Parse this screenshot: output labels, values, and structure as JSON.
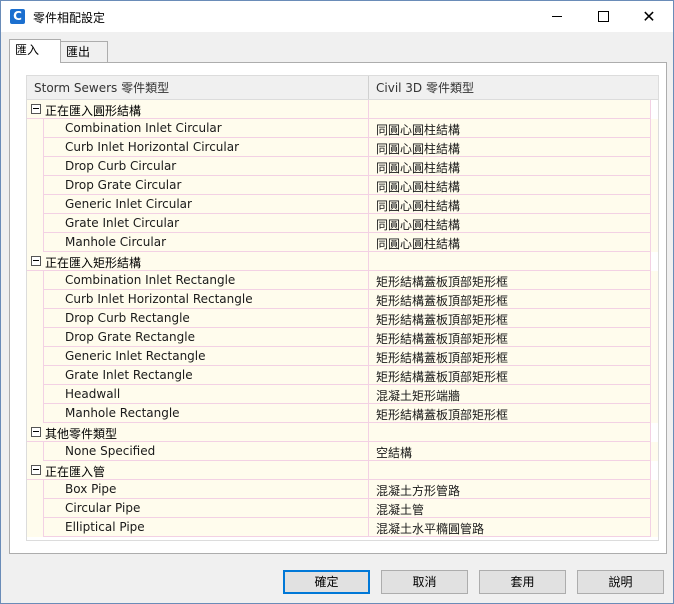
{
  "window": {
    "title": "零件相配設定",
    "app_icon_letter": "C"
  },
  "tabs": [
    {
      "label": "匯入",
      "active": true
    },
    {
      "label": "匯出",
      "active": false
    }
  ],
  "grid": {
    "columns": [
      "Storm Sewers 零件類型",
      "Civil 3D 零件類型"
    ],
    "groups": [
      {
        "label": "正在匯入圓形結構",
        "items": [
          {
            "name": "Combination Inlet Circular",
            "value": "同圓心圓柱結構"
          },
          {
            "name": "Curb Inlet Horizontal Circular",
            "value": "同圓心圓柱結構"
          },
          {
            "name": "Drop Curb Circular",
            "value": "同圓心圓柱結構"
          },
          {
            "name": "Drop Grate Circular",
            "value": "同圓心圓柱結構"
          },
          {
            "name": "Generic Inlet Circular",
            "value": "同圓心圓柱結構"
          },
          {
            "name": "Grate Inlet Circular",
            "value": "同圓心圓柱結構"
          },
          {
            "name": "Manhole Circular",
            "value": "同圓心圓柱結構"
          }
        ]
      },
      {
        "label": "正在匯入矩形結構",
        "items": [
          {
            "name": "Combination Inlet Rectangle",
            "value": "矩形結構蓋板頂部矩形框"
          },
          {
            "name": "Curb Inlet Horizontal Rectangle",
            "value": "矩形結構蓋板頂部矩形框"
          },
          {
            "name": "Drop Curb Rectangle",
            "value": "矩形結構蓋板頂部矩形框"
          },
          {
            "name": "Drop Grate Rectangle",
            "value": "矩形結構蓋板頂部矩形框"
          },
          {
            "name": "Generic Inlet Rectangle",
            "value": "矩形結構蓋板頂部矩形框"
          },
          {
            "name": "Grate Inlet Rectangle",
            "value": "矩形結構蓋板頂部矩形框"
          },
          {
            "name": "Headwall",
            "value": "混凝土矩形端牆"
          },
          {
            "name": "Manhole Rectangle",
            "value": "矩形結構蓋板頂部矩形框"
          }
        ]
      },
      {
        "label": "其他零件類型",
        "items": [
          {
            "name": "None Specified",
            "value": "空結構"
          }
        ]
      },
      {
        "label": "正在匯入管",
        "items": [
          {
            "name": "Box Pipe",
            "value": "混凝土方形管路"
          },
          {
            "name": "Circular Pipe",
            "value": "混凝土管"
          },
          {
            "name": "Elliptical Pipe",
            "value": "混凝土水平橢圓管路"
          }
        ]
      }
    ]
  },
  "buttons": {
    "ok": "確定",
    "cancel": "取消",
    "apply": "套用",
    "help": "說明"
  },
  "colors": {
    "accent": "#0078d7",
    "row_bg": "#fffced",
    "grid_line": "#f3d1e4"
  }
}
